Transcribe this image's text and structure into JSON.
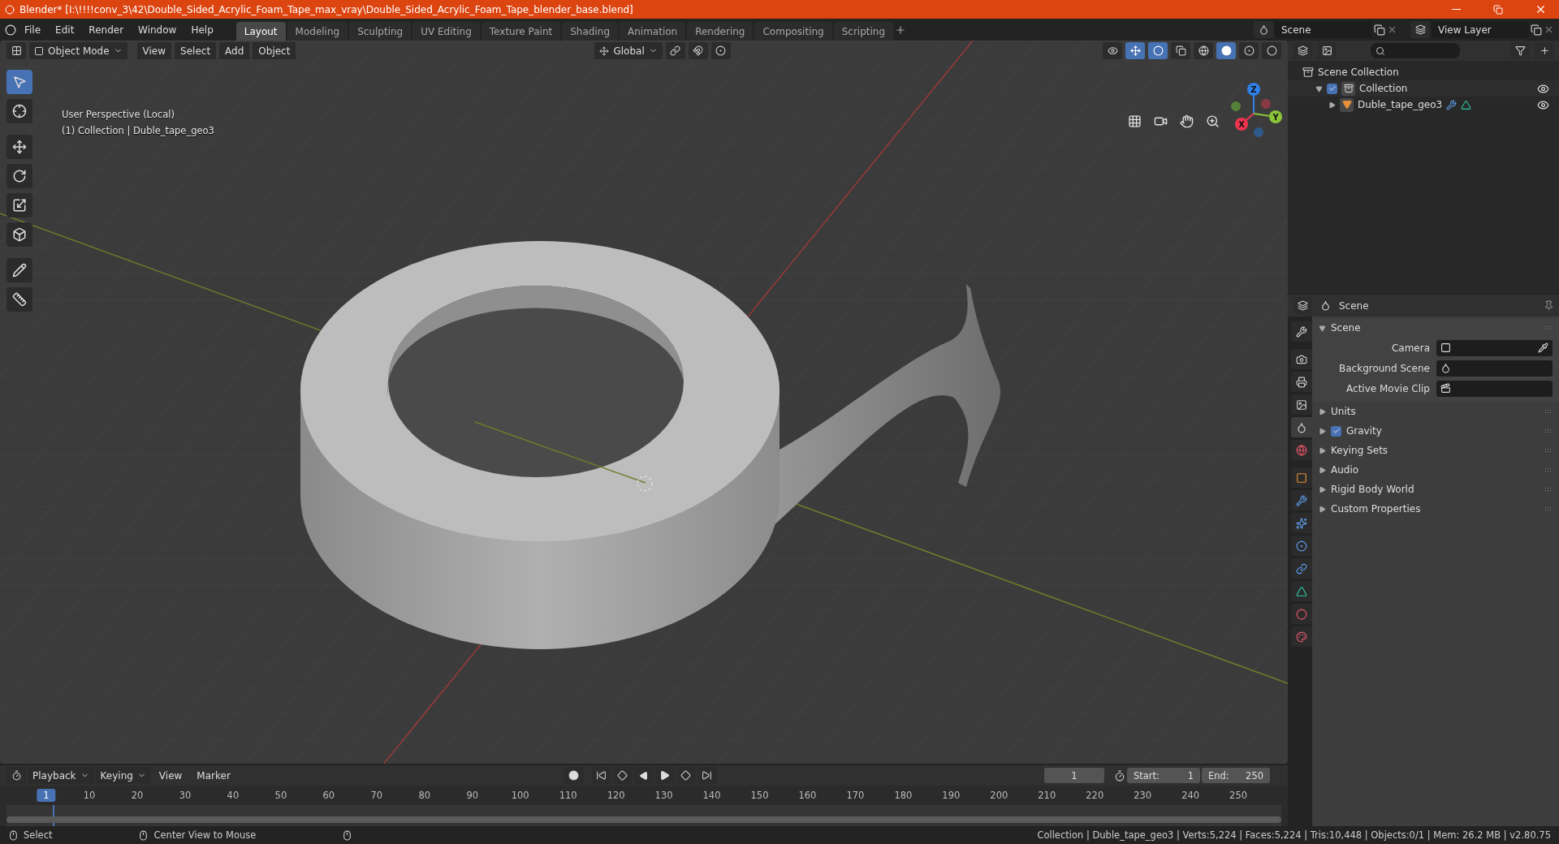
{
  "title_bar": {
    "title": "Blender* [I:\\!!!!conv_3\\42\\Double_Sided_Acrylic_Foam_Tape_max_vray\\Double_Sided_Acrylic_Foam_Tape_blender_base.blend]"
  },
  "menu": [
    "File",
    "Edit",
    "Render",
    "Window",
    "Help"
  ],
  "workspaces": [
    {
      "label": "Layout",
      "selected": true
    },
    {
      "label": "Modeling",
      "selected": false
    },
    {
      "label": "Sculpting",
      "selected": false
    },
    {
      "label": "UV Editing",
      "selected": false
    },
    {
      "label": "Texture Paint",
      "selected": false
    },
    {
      "label": "Shading",
      "selected": false
    },
    {
      "label": "Animation",
      "selected": false
    },
    {
      "label": "Rendering",
      "selected": false
    },
    {
      "label": "Compositing",
      "selected": false
    },
    {
      "label": "Scripting",
      "selected": false
    }
  ],
  "scene_field": {
    "value": "Scene"
  },
  "view_layer_field": {
    "value": "View Layer"
  },
  "viewport_header": {
    "mode": "Object Mode",
    "menus": [
      "View",
      "Select",
      "Add",
      "Object"
    ],
    "orientation": "Global"
  },
  "tools": [
    {
      "kind": "select",
      "selected": true
    },
    {
      "kind": "cursor",
      "selected": false
    },
    {
      "kind": "move",
      "selected": false
    },
    {
      "kind": "rotate",
      "selected": false
    },
    {
      "kind": "scale",
      "selected": false
    },
    {
      "kind": "transform",
      "selected": false
    },
    {
      "kind": "annotate",
      "selected": false
    },
    {
      "kind": "measure",
      "selected": false
    }
  ],
  "viewport": {
    "info": [
      "User Perspective (Local)",
      "(1) Collection | Duble_tape_geo3"
    ],
    "gizmo_axes": [
      {
        "label": "Z",
        "color": "#2f80e8"
      },
      {
        "label": "Y",
        "color": "#8bc43a"
      },
      {
        "label": "X",
        "color": "#f0344f"
      }
    ]
  },
  "outliner": {
    "items": [
      {
        "label": "Scene Collection",
        "kind": "scene_collection",
        "children": [
          {
            "label": "Collection",
            "kind": "collection",
            "checked": true,
            "expanded": true,
            "children": [
              {
                "label": "Duble_tape_geo3",
                "kind": "mesh",
                "expanded": false
              }
            ]
          }
        ]
      }
    ]
  },
  "properties": {
    "header": "Scene",
    "tabs": [
      {
        "kind": "tool",
        "selected": false
      },
      {
        "kind": "render",
        "selected": false
      },
      {
        "kind": "output",
        "selected": false
      },
      {
        "kind": "view_layer",
        "selected": false
      },
      {
        "kind": "scene",
        "selected": true
      },
      {
        "kind": "world",
        "selected": false
      },
      {
        "kind": "object",
        "selected": false
      },
      {
        "kind": "modifiers",
        "selected": false
      },
      {
        "kind": "particles",
        "selected": false
      },
      {
        "kind": "physics",
        "selected": false
      },
      {
        "kind": "constraints",
        "selected": false
      },
      {
        "kind": "data",
        "selected": false
      },
      {
        "kind": "material",
        "selected": false
      },
      {
        "kind": "texture",
        "selected": false
      }
    ],
    "panels": [
      {
        "label": "Scene",
        "expanded": true,
        "fields": [
          {
            "label": "Camera",
            "kind": "camera"
          },
          {
            "label": "Background Scene",
            "kind": "scene"
          },
          {
            "label": "Active Movie Clip",
            "kind": "clip"
          }
        ]
      },
      {
        "label": "Units",
        "expanded": false
      },
      {
        "label": "Gravity",
        "expanded": false,
        "checked": true
      },
      {
        "label": "Keying Sets",
        "expanded": false
      },
      {
        "label": "Audio",
        "expanded": false
      },
      {
        "label": "Rigid Body World",
        "expanded": false
      },
      {
        "label": "Custom Properties",
        "expanded": false
      }
    ]
  },
  "timeline": {
    "menus": [
      "Playback",
      "Keying",
      "View",
      "Marker"
    ],
    "current_frame": "1",
    "start_label": "Start:",
    "start": "1",
    "end_label": "End:",
    "end": "250",
    "ruler": [
      "1",
      "10",
      "20",
      "30",
      "40",
      "50",
      "60",
      "70",
      "80",
      "90",
      "100",
      "110",
      "120",
      "130",
      "140",
      "150",
      "160",
      "170",
      "180",
      "190",
      "200",
      "210",
      "220",
      "230",
      "240",
      "250"
    ]
  },
  "status_bar": {
    "hints": [
      "Select",
      "Center View to Mouse"
    ],
    "stats": "Collection | Duble_tape_geo3 | Verts:5,224 | Faces:5,224 | Tris:10,448 | Objects:0/1 | Mem: 26.2 MB | v2.80.75"
  }
}
